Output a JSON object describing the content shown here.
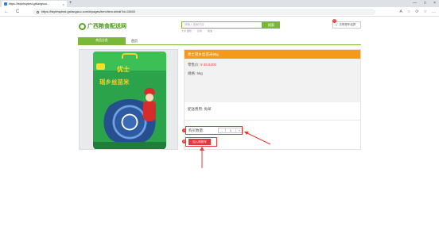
{
  "browser": {
    "tab_title": "https://fsiyhhsptest.gxliangsuo...",
    "tab_close": "×",
    "new_tab": "+",
    "window_controls": [
      "—",
      "□",
      "×"
    ],
    "url": "https://fsiyhhsptest.gxliangsuo.com/#/pages/item/item-detail?id=28000",
    "nav_back": "←",
    "nav_refresh": "C",
    "toolbar_icons": [
      "A",
      "☆",
      "⟳",
      "☆",
      "…"
    ]
  },
  "header": {
    "logo_text": "广西粮食配送网",
    "search_placeholder": "请输入搜索内容",
    "search_button": "搜索",
    "hot_words": [
      "大米 面粉",
      "食用",
      "粮油"
    ],
    "cart_count": "0",
    "cart_label": "🛒 去购物车结算"
  },
  "nav": {
    "category_label": "商品分类",
    "home_label": "首页"
  },
  "product": {
    "title": "优士瑶乡丝苗米5kg",
    "price_label": "零售价:",
    "price_value": "¥ 26.5200",
    "spec_label": "规格:",
    "spec_value": "5kg",
    "shipping_label": "配送费用:",
    "shipping_value": "免邮",
    "qty_label": "购买数量:",
    "qty_minus": "-",
    "qty_value": "1",
    "qty_plus": "+",
    "add_to_cart": "加入购物车",
    "image_brand": "优士",
    "image_name": "瑶乡丝苗米"
  },
  "annotations": {
    "step1": "1",
    "step2": "2",
    "color": "#e53935"
  }
}
